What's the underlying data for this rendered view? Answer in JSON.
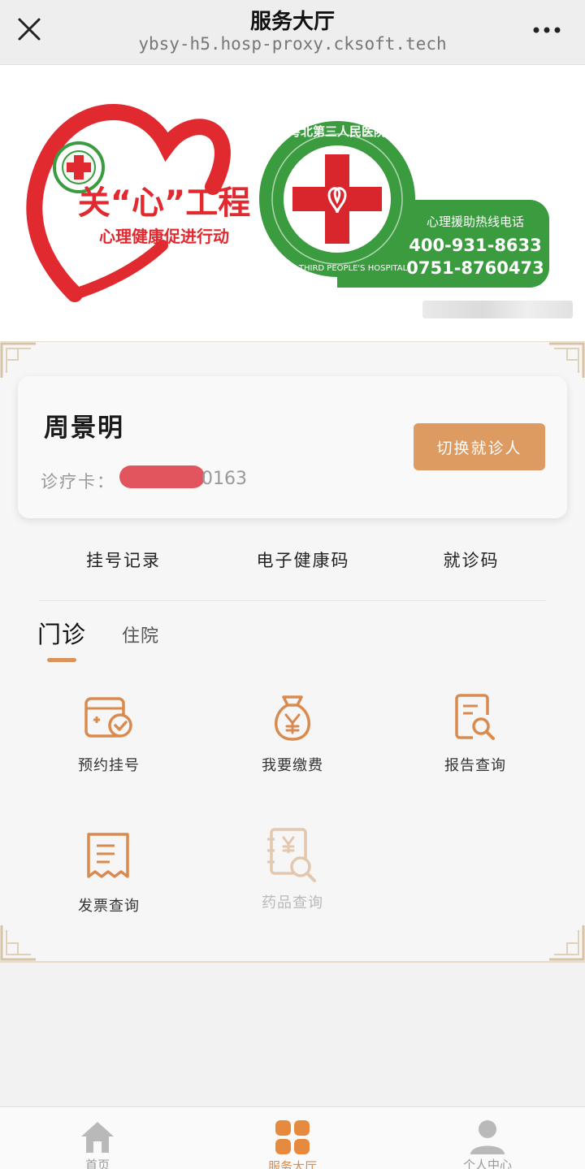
{
  "header": {
    "title": "服务大厅",
    "url": "ybsy-h5.hosp-proxy.cksoft.tech"
  },
  "banner": {
    "campaign_title": "关“心”工程",
    "campaign_subtitle": "心理健康促进行动",
    "hospital_name_cn": "粤北第三人民医院",
    "hospital_name_en": "YUEBEI THIRD PEOPLE'S HOSPITAL",
    "hotline_label": "心理援助热线电话",
    "hotline_1": "400-931-8633",
    "hotline_2": "0751-8760473",
    "colors": {
      "heart_red": "#e02a2f",
      "hospital_green": "#3a9b3f"
    }
  },
  "patient_card": {
    "name": "周景明",
    "card_label": "诊疗卡：",
    "card_number_visible_suffix": "0163",
    "switch_button": "切换就诊人"
  },
  "quick_links": [
    "挂号记录",
    "电子健康码",
    "就诊码"
  ],
  "tabs": [
    {
      "label": "门诊",
      "active": true
    },
    {
      "label": "住院",
      "active": false
    }
  ],
  "services": [
    {
      "label": "预约挂号",
      "icon": "calendar-check-icon",
      "enabled": true
    },
    {
      "label": "我要缴费",
      "icon": "yuan-bag-icon",
      "enabled": true
    },
    {
      "label": "报告查询",
      "icon": "report-search-icon",
      "enabled": true
    },
    {
      "label": "发票查询",
      "icon": "receipt-icon",
      "enabled": true
    },
    {
      "label": "药品查询",
      "icon": "drug-search-icon",
      "enabled": false
    }
  ],
  "bottom_nav": [
    {
      "label": "首页",
      "icon": "home-icon",
      "active": false
    },
    {
      "label": "服务大厅",
      "icon": "grid-icon",
      "active": true
    },
    {
      "label": "个人中心",
      "icon": "user-icon",
      "active": false
    }
  ],
  "colors": {
    "accent": "#d98b4f",
    "button": "#dd9a61",
    "disabled": "#e3c7ae"
  }
}
